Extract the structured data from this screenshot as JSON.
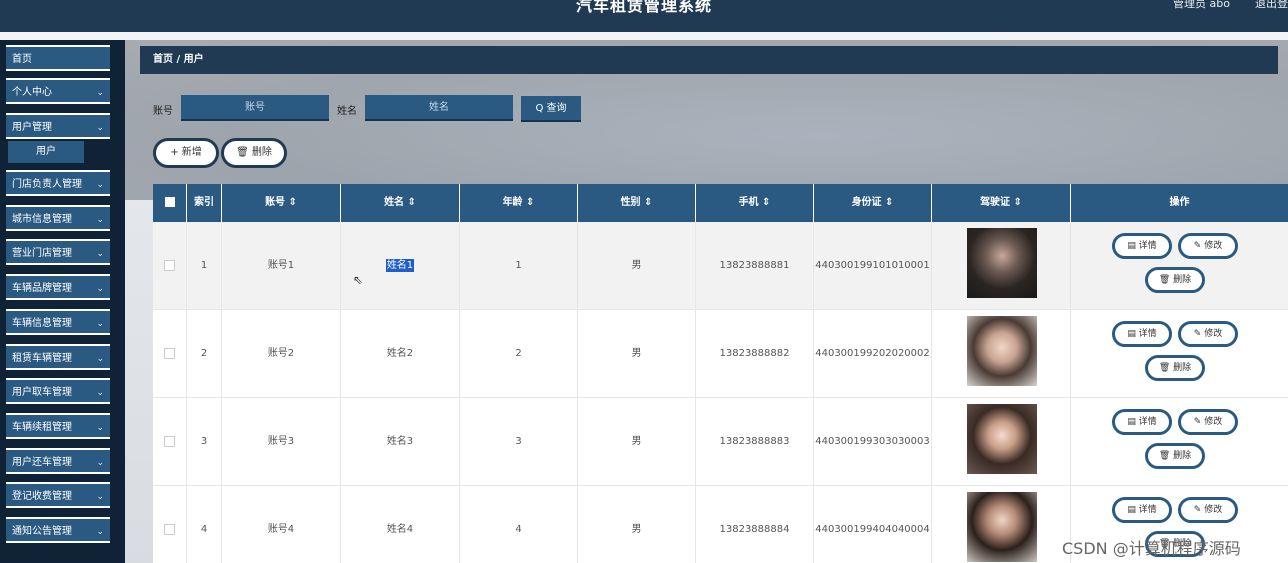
{
  "header": {
    "title": "汽车租赁管理系统",
    "user": "管理员 abo",
    "logout": "退出登"
  },
  "sidebar": {
    "items": [
      {
        "label": "首页",
        "chevron": ""
      },
      {
        "label": "个人中心",
        "chevron": "⌄"
      },
      {
        "label": "用户管理",
        "chevron": "⌄"
      },
      {
        "label": "门店负责人管理",
        "chevron": "⌄"
      },
      {
        "label": "城市信息管理",
        "chevron": "⌄"
      },
      {
        "label": "营业门店管理",
        "chevron": "⌄"
      },
      {
        "label": "车辆品牌管理",
        "chevron": "⌄"
      },
      {
        "label": "车辆信息管理",
        "chevron": "⌄"
      },
      {
        "label": "租赁车辆管理",
        "chevron": "⌄"
      },
      {
        "label": "用户取车管理",
        "chevron": "⌄"
      },
      {
        "label": "车辆续租管理",
        "chevron": "⌄"
      },
      {
        "label": "用户还车管理",
        "chevron": "⌄"
      },
      {
        "label": "登记收费管理",
        "chevron": "⌄"
      },
      {
        "label": "通知公告管理",
        "chevron": "⌄"
      }
    ],
    "submenu": {
      "label": "用户"
    }
  },
  "breadcrumb": {
    "text": "首页 / 用户"
  },
  "search": {
    "account_label": "账号",
    "account_placeholder": "账号",
    "name_label": "姓名",
    "name_placeholder": "姓名",
    "query_icon": "search-icon",
    "query_label": "Q 查询"
  },
  "actions": {
    "add_label": "+ 新增",
    "delete_label": "🗑 删除"
  },
  "table": {
    "headers": [
      "",
      "索引",
      "账号 ⇕",
      "姓名 ⇕",
      "年龄 ⇕",
      "性别 ⇕",
      "手机 ⇕",
      "身份证 ⇕",
      "驾驶证 ⇕",
      "操作"
    ],
    "rows": [
      {
        "index": "1",
        "account": "账号1",
        "name": "姓名1",
        "age": "1",
        "gender": "男",
        "phone": "13823888881",
        "id_card": "440300199101010001"
      },
      {
        "index": "2",
        "account": "账号2",
        "name": "姓名2",
        "age": "2",
        "gender": "男",
        "phone": "13823888882",
        "id_card": "440300199202020002"
      },
      {
        "index": "3",
        "account": "账号3",
        "name": "姓名3",
        "age": "3",
        "gender": "男",
        "phone": "13823888883",
        "id_card": "440300199303030003"
      },
      {
        "index": "4",
        "account": "账号4",
        "name": "姓名4",
        "age": "4",
        "gender": "男",
        "phone": "13823888884",
        "id_card": "440300199404040004"
      }
    ],
    "ops": {
      "detail": "▤ 详情",
      "edit": "✎ 修改",
      "delete": "🗑 删除"
    }
  },
  "watermark": "CSDN @计算机程序源码"
}
